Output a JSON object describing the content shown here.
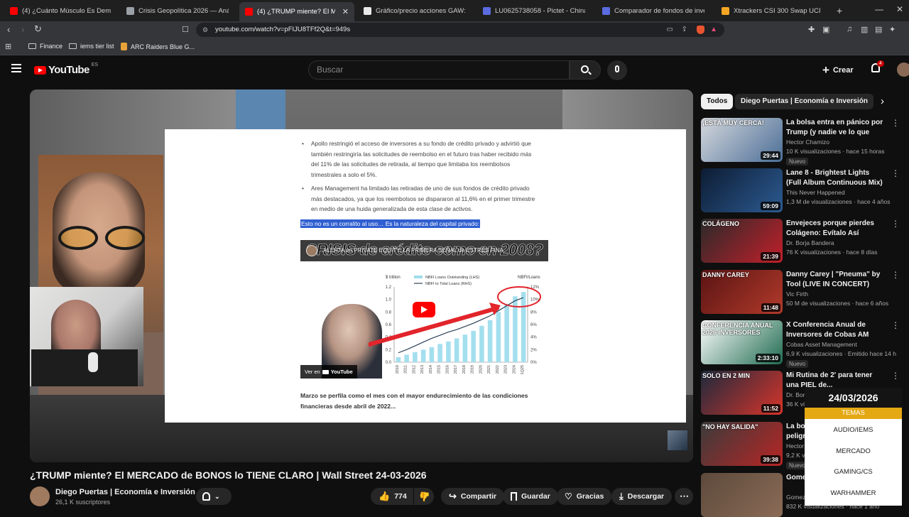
{
  "browser": {
    "tabs": [
      {
        "title": "(4) ¿Cuánto Músculo Es Demasiado?",
        "color": "#ff0000"
      },
      {
        "title": "Crisis Geopolítica 2026 — Análisis de",
        "color": "#9aa0a6"
      },
      {
        "title": "(4) ¿TRUMP miente? El MERCADO",
        "color": "#ff0000"
      },
      {
        "title": "Gráfico/precio acciones GAW: LSE:GA",
        "color": "#e8e8e8"
      },
      {
        "title": "LU0625738058 - Pictet - China Index",
        "color": "#5b6be0"
      },
      {
        "title": "Comparador de fondos de inversión",
        "color": "#5b6be0"
      },
      {
        "title": "Xtrackers CSI 300 Swap UCITS ETF 1C",
        "color": "#f5a623"
      }
    ],
    "url": "youtube.com/watch?v=pFIJU8TFf2Q&t=949s",
    "bookmarks": [
      "Finance",
      "iems tier list",
      "ARC Raiders Blue G..."
    ]
  },
  "youtube": {
    "logo_text": "YouTube",
    "region": "ES",
    "search_placeholder": "Buscar",
    "create_label": "Crear",
    "notification_count": "4"
  },
  "video": {
    "doc": {
      "bullets": [
        "Apollo restringió el acceso de inversores a su fondo de crédito privado y advirtió que también restringiría las solicitudes de reembolso en el futuro tras haber recibido más del 11% de las solicitudes de retirada, al tiempo que limitaba los reembolsos trimestrales a solo el 5%.",
        "Ares Management ha limitado las retiradas de uno de sus fondos de crédito privado más destacados, ya que los reembolsos se dispararon al 11,6% en el primer trimestre en medio de una huida generalizada de esta clase de activos."
      ],
      "highlight": "Esto no es un corralito al uso… Es la naturaleza del capital privado:",
      "embed_title": "CRISIS de crédito como en 2008?",
      "embed_alert": "ALERTA en PRIVATE EQUITY: LA PRIMERA SEÑAL de ESTRÉS FINA",
      "watch_on": "Ver en",
      "watch_on_brand": "YouTube",
      "closing": "Marzo se perfila como el mes con el mayor endurecimiento de las condiciones financieras desde abril de 2022..."
    },
    "title": "¿TRUMP miente? El MERCADO de BONOS lo TIENE CLARO | Wall Street 24-03-2026",
    "channel": "Diego Puertas | Economía e Inversión",
    "subscribers": "26,1 K suscriptores",
    "actions": {
      "likes": "774",
      "share": "Compartir",
      "save": "Guardar",
      "thanks": "Gracias",
      "download": "Descargar"
    }
  },
  "chart_data": {
    "type": "bar",
    "title": "",
    "ylabel_left": "$ trillion",
    "ylabel_right": "NBFI/Loans",
    "legend": [
      "NBFI Loans Outstanding (LHS)",
      "NBFI to Total Loans (RHS)"
    ],
    "categories": [
      "2010",
      "2011",
      "2012",
      "2013",
      "2014",
      "2015",
      "2016",
      "2017",
      "2018",
      "2019",
      "2020",
      "2021",
      "2022",
      "2023",
      "2024",
      "1Q25"
    ],
    "series": [
      {
        "name": "NBFI Loans Outstanding (LHS)",
        "values": [
          0.08,
          0.12,
          0.16,
          0.2,
          0.24,
          0.29,
          0.33,
          0.38,
          0.44,
          0.5,
          0.58,
          0.67,
          0.8,
          0.93,
          1.05,
          1.12
        ]
      },
      {
        "name": "NBFI to Total Loans (RHS)",
        "values": [
          1.5,
          2.0,
          2.6,
          3.2,
          3.8,
          4.3,
          4.8,
          5.2,
          5.7,
          6.2,
          6.8,
          7.4,
          8.2,
          9.0,
          9.8,
          10.3
        ]
      }
    ],
    "ylim_left": [
      0,
      1.2
    ],
    "yticks_left": [
      "0.0",
      "0.2",
      "0.4",
      "0.6",
      "0.8",
      "1.0",
      "1.2"
    ],
    "ylim_right": [
      0,
      12
    ],
    "yticks_right": [
      "0%",
      "2%",
      "4%",
      "6%",
      "8%",
      "10%",
      "12%"
    ]
  },
  "sidebar": {
    "chips": [
      "Todos",
      "Diego Puertas | Economía e Inversión"
    ],
    "recommendations": [
      {
        "title": "La bolsa entra en pánico por Trump (y nadie ve lo que viene...",
        "channel": "Hector Chamizo",
        "meta": "10 K visualizaciones · hace 15 horas",
        "duration": "29:44",
        "badge": "Nuevo",
        "thumb_text": "¡ESTÁ MUY CERCA!",
        "colors": [
          "#d6d9de",
          "#4b6e96"
        ]
      },
      {
        "title": "Lane 8 - Brightest Lights (Full Album Continuous Mix)",
        "channel": "This Never Happened",
        "meta": "1,3 M de visualizaciones · hace 4 años",
        "duration": "59:09",
        "badge": "",
        "thumb_text": "",
        "colors": [
          "#0d1c33",
          "#2c5b92"
        ]
      },
      {
        "title": "Envejeces porque pierdes Colágeno: Evítalo Así",
        "channel": "Dr. Borja Bandera",
        "meta": "76 K visualizaciones · hace 8 días",
        "duration": "21:39",
        "badge": "",
        "thumb_text": "COLÁGENO",
        "colors": [
          "#2a2a2a",
          "#c21f2a"
        ]
      },
      {
        "title": "Danny Carey | \"Pneuma\" by Tool (LIVE IN CONCERT)",
        "channel": "Vic Firth",
        "meta": "50 M de visualizaciones · hace 6 años",
        "duration": "11:48",
        "badge": "",
        "thumb_text": "DANNY CAREY",
        "colors": [
          "#5a1414",
          "#b23a2a"
        ]
      },
      {
        "title": "X Conferencia Anual de Inversores de Cobas AM 2026",
        "channel": "Cobas Asset Management",
        "meta": "6,9 K visualizaciones · Emitido hace 14 h",
        "duration": "2:33:10",
        "badge": "Nuevo",
        "thumb_text": "CONFERENCIA ANUAL 2026 INVERSORES",
        "colors": [
          "#ffffff",
          "#1f6b50"
        ]
      },
      {
        "title": "Mi Rutina de 2' para tener una PIEL de...",
        "channel": "Dr. Borja Bandera",
        "meta": "36 K visualizaciones · hace 2 semanas",
        "duration": "11:52",
        "badge": "",
        "thumb_text": "SOLO EN 2 MIN",
        "colors": [
          "#1d2a3d",
          "#d8342a"
        ]
      },
      {
        "title": "La bolsa se está metiendo en peligro...",
        "channel": "Hector Chamizo",
        "meta": "9,2 K visualizaciones · hace 1 día",
        "duration": "39:38",
        "badge": "Nuevo",
        "thumb_text": "\"NO HAY SALIDA\"",
        "colors": [
          "#3b3b3b",
          "#b82525"
        ]
      },
      {
        "title": "Gomez...",
        "channel": "Gomez",
        "meta": "832 K visualizaciones · hace 1 año",
        "duration": "",
        "badge": "",
        "thumb_text": "",
        "colors": [
          "#5d4a3c",
          "#8a6b56"
        ]
      }
    ]
  },
  "overlay": {
    "date": "24/03/2026",
    "header": "TEMAS",
    "topics": [
      "AUDIO/IEMS",
      "MERCADO",
      "GAMING/CS",
      "WARHAMMER"
    ]
  }
}
